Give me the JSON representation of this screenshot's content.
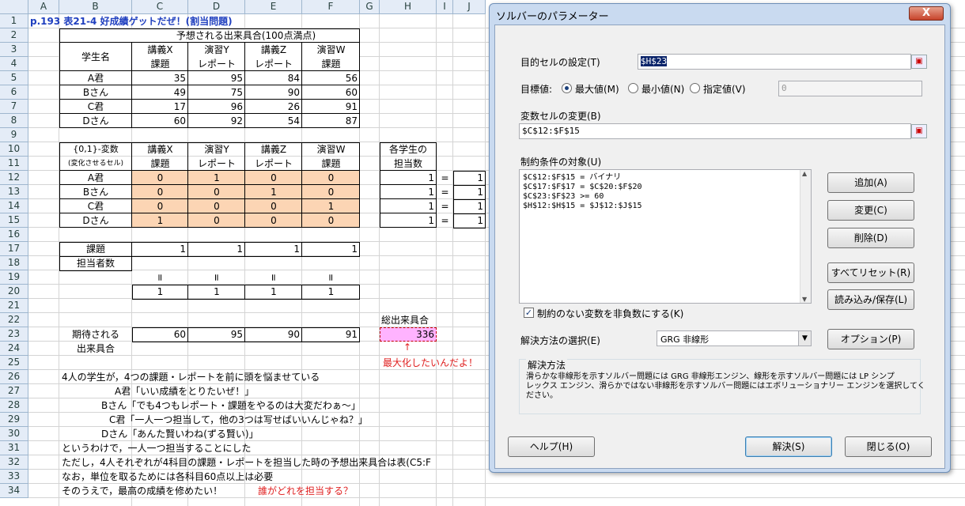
{
  "sheet": {
    "columns": [
      "A",
      "B",
      "C",
      "D",
      "E",
      "F",
      "G",
      "H",
      "I",
      "J"
    ],
    "rows": [
      "1",
      "2",
      "3",
      "4",
      "5",
      "6",
      "7",
      "8",
      "9",
      "10",
      "11",
      "12",
      "13",
      "14",
      "15",
      "16",
      "17",
      "18",
      "19",
      "20",
      "21",
      "22",
      "23",
      "24",
      "25",
      "26",
      "27",
      "28",
      "29",
      "30",
      "31",
      "32",
      "33",
      "34"
    ],
    "title": "p.193 表21-4 好成績ゲットだぜ！(割当問題)",
    "t1": {
      "header_top": "予想される出来具合(100点満点)",
      "student_label": "学生名",
      "col_a": [
        "講義X",
        "演習Y",
        "講義Z",
        "演習W"
      ],
      "col_b": [
        "課題",
        "レポート",
        "レポート",
        "課題"
      ],
      "rows": [
        {
          "name": "A君",
          "v": [
            "35",
            "95",
            "84",
            "56"
          ]
        },
        {
          "name": "Bさん",
          "v": [
            "49",
            "75",
            "90",
            "60"
          ]
        },
        {
          "name": "C君",
          "v": [
            "17",
            "96",
            "26",
            "91"
          ]
        },
        {
          "name": "Dさん",
          "v": [
            "60",
            "92",
            "54",
            "87"
          ]
        }
      ]
    },
    "t2": {
      "label1": "{0,1}-変数",
      "label2": "(変化させるセル)",
      "col_a": [
        "講義X",
        "演習Y",
        "講義Z",
        "演習W"
      ],
      "col_b": [
        "課題",
        "レポート",
        "レポート",
        "課題"
      ],
      "rows": [
        {
          "name": "A君",
          "v": [
            "0",
            "1",
            "0",
            "0"
          ]
        },
        {
          "name": "Bさん",
          "v": [
            "0",
            "0",
            "1",
            "0"
          ]
        },
        {
          "name": "C君",
          "v": [
            "0",
            "0",
            "0",
            "1"
          ]
        },
        {
          "name": "Dさん",
          "v": [
            "1",
            "0",
            "0",
            "0"
          ]
        }
      ],
      "per_student_label1": "各学生の",
      "per_student_label2": "担当数",
      "per_student": [
        "1",
        "1",
        "1",
        "1"
      ],
      "eq": "=",
      "per_student_rhs": [
        "1",
        "1",
        "1",
        "1"
      ]
    },
    "t3": {
      "label1": "課題",
      "label2": "担当者数",
      "v": [
        "1",
        "1",
        "1",
        "1"
      ],
      "eq": "=",
      "rhs": [
        "1",
        "1",
        "1",
        "1"
      ]
    },
    "t4": {
      "label1": "期待される",
      "label2": "出来具合",
      "v": [
        "60",
        "95",
        "90",
        "91"
      ],
      "total_label": "総出来具合",
      "total": "336",
      "arrow": "↑",
      "maximize_note": "最大化したいんだよ！"
    },
    "story": [
      "4人の学生が，4つの課題・レポートを前に頭を悩ませている",
      "A君「いい成績をとりたいぜ！」",
      "Bさん「でも4つもレポート・課題をやるのは大変だわぁ〜」",
      "C君「一人一つ担当して，他の3つは写せばいいんじゃね？」",
      "Dさん「あんた賢いわね(ずる賢い)」",
      "というわけで，一人一つ担当することにした",
      "ただし，4人それぞれが4科目の課題・レポートを担当した時の予想出来具合は表(C5:F",
      "なお，単位を取るためには各科目60点以上は必要",
      "そのうえで，最高の成績を修めたい！"
    ],
    "story_red": "誰がどれを担当する？"
  },
  "dialog": {
    "title": "ソルバーのパラメーター",
    "close": "X",
    "target_label": "目的セルの設定(T)",
    "target_value": "$H$23",
    "goal_label": "目標値:",
    "goal_options": [
      "最大値(M)",
      "最小値(N)",
      "指定値(V)"
    ],
    "goal_selected": "最大値(M)",
    "value_of": "0",
    "changing_label": "変数セルの変更(B)",
    "changing_value": "$C$12:$F$15",
    "constraints_label": "制約条件の対象(U)",
    "constraints": [
      "$C$12:$F$15 = バイナリ",
      "$C$17:$F$17 = $C$20:$F$20",
      "$C$23:$F$23 >= 60",
      "$H$12:$H$15 = $J$12:$J$15"
    ],
    "buttons": [
      "追加(A)",
      "変更(C)",
      "削除(D)",
      "すべてリセット(R)",
      "読み込み/保存(L)"
    ],
    "nonneg_label": "制約のない変数を非負数にする(K)",
    "nonneg_checked": true,
    "method_label": "解決方法の選択(E)",
    "method_value": "GRG 非線形",
    "options_button": "オプション(P)",
    "group_title": "解決方法",
    "group_text1": "滑らかな非線形を示すソルバー問題には GRG 非線形エンジン、線形を示すソルバー問題には LP シンプ",
    "group_text2": "レックス エンジン、滑らかではない非線形を示すソルバー問題にはエボリューショナリー エンジンを選択してく",
    "group_text3": "ださい。",
    "help": "ヘルプ(H)",
    "solve": "解決(S)",
    "closebtn": "閉じる(O)"
  },
  "colors": {
    "header_bg": "#e4ecf7",
    "peach": "#fcd5b4",
    "pink": "#ffb3ff",
    "title_blue": "#1f3fbf",
    "red": "#e02020",
    "dialog_frame": "#c9daf0"
  }
}
